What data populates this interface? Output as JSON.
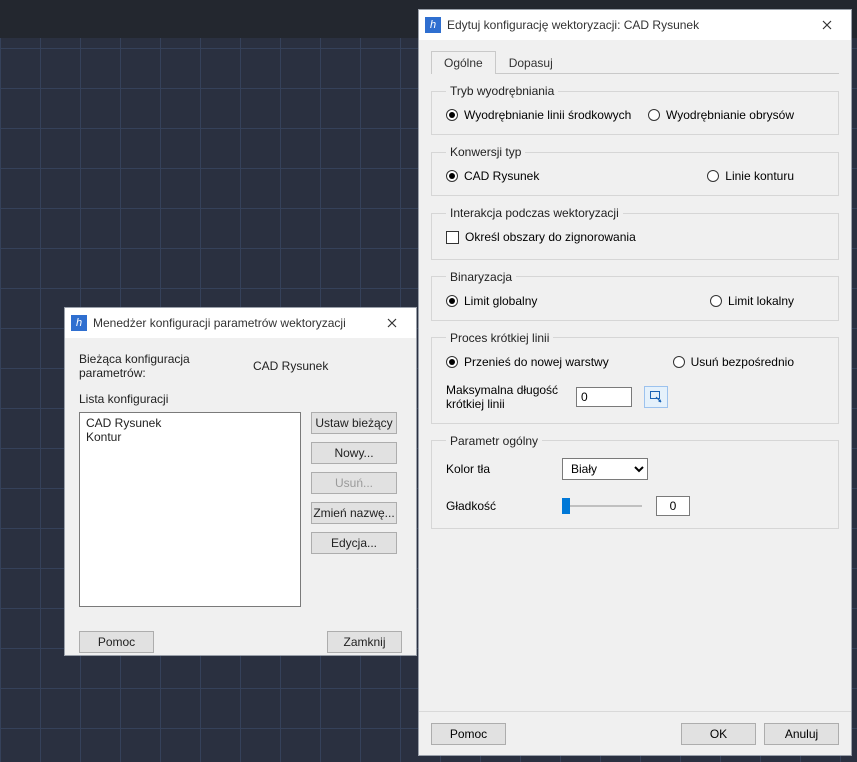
{
  "mgr": {
    "title": "Menedżer konfiguracji parametrów wektoryzacji",
    "current_label": "Bieżąca konfiguracja parametrów:",
    "current_value": "CAD Rysunek",
    "list_label": "Lista konfiguracji",
    "items": [
      "CAD Rysunek",
      "Kontur"
    ],
    "buttons": {
      "set_current": "Ustaw bieżący",
      "new": "Nowy...",
      "delete": "Usuń...",
      "rename": "Zmień nazwę...",
      "edit": "Edycja..."
    },
    "help": "Pomoc",
    "close": "Zamknij"
  },
  "cfg": {
    "title": "Edytuj konfigurację wektoryzacji: CAD Rysunek",
    "tabs": {
      "general": "Ogólne",
      "fit": "Dopasuj"
    },
    "extraction": {
      "legend": "Tryb wyodrębniania",
      "centerlines": "Wyodrębnianie linii środkowych",
      "outlines": "Wyodrębnianie obrysów"
    },
    "conversion": {
      "legend": "Konwersji typ",
      "cad": "CAD Rysunek",
      "contour": "Linie konturu"
    },
    "interaction": {
      "legend": "Interakcja podczas wektoryzacji",
      "define_areas": "Określ obszary do zignorowania"
    },
    "binarization": {
      "legend": "Binaryzacja",
      "global": "Limit globalny",
      "local": "Limit lokalny"
    },
    "shortline": {
      "legend": "Proces krótkiej linii",
      "move": "Przenieś do nowej warstwy",
      "delete": "Usuń bezpośrednio",
      "maxlen_label": "Maksymalna długość krótkiej linii",
      "maxlen_value": "0"
    },
    "general": {
      "legend": "Parametr ogólny",
      "bg_color_label": "Kolor tła",
      "bg_color_value": "Biały",
      "smooth_label": "Gładkość",
      "smooth_value": "0"
    },
    "help": "Pomoc",
    "ok": "OK",
    "cancel": "Anuluj"
  }
}
